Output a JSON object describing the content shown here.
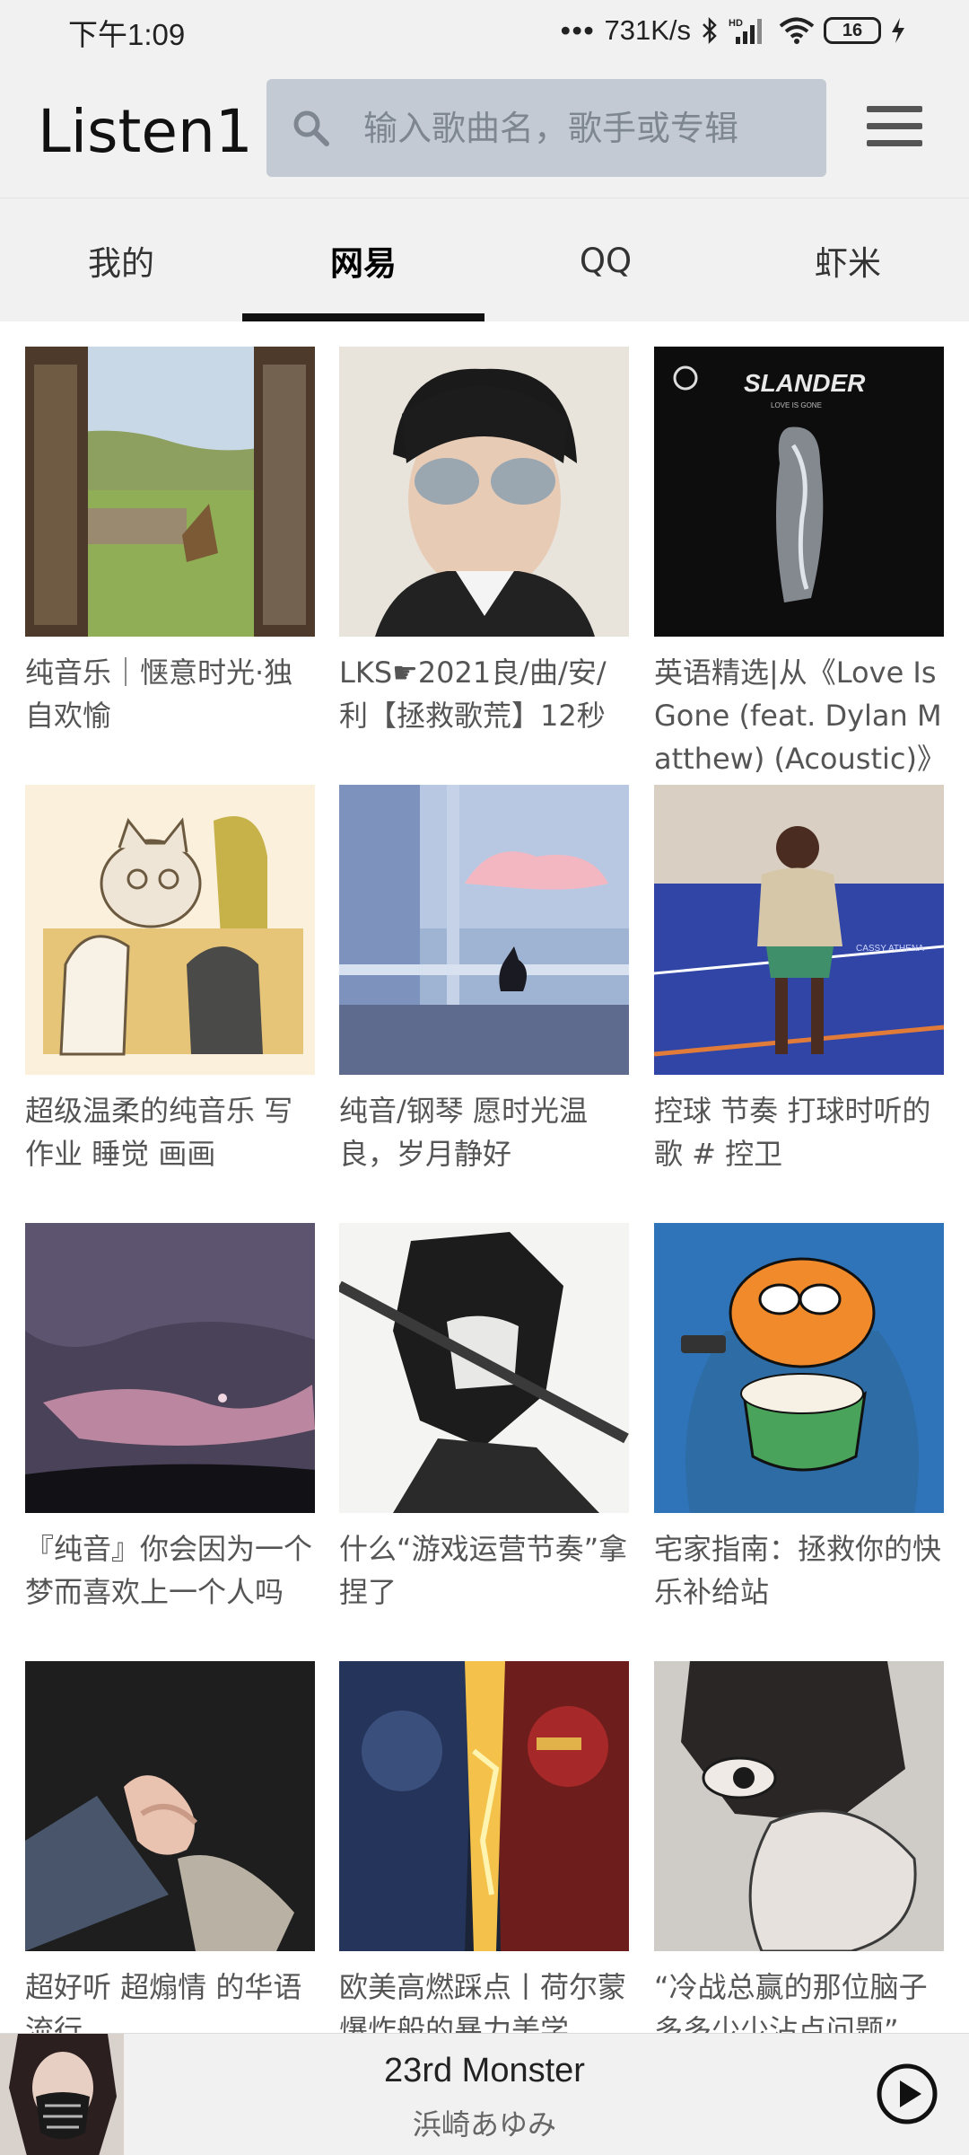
{
  "status_bar": {
    "time": "下午1:09",
    "network_speed": "731K/s",
    "battery": "16",
    "icons": [
      "bluetooth-icon",
      "hd-signal-icon",
      "wifi-icon",
      "battery-icon",
      "charging-icon"
    ]
  },
  "header": {
    "app_title": "Listen1",
    "search_placeholder": "输入歌曲名，歌手或专辑"
  },
  "tabs": [
    {
      "label": "我的",
      "active": false
    },
    {
      "label": "网易",
      "active": true
    },
    {
      "label": "QQ",
      "active": false
    },
    {
      "label": "虾米",
      "active": false
    }
  ],
  "playlists": [
    {
      "title": "纯音乐｜惬意时光·独自欢愉"
    },
    {
      "title": "LKS☛2021良/曲/安/利【拯救歌荒】12秒"
    },
    {
      "title": "英语精选|从《Love Is Gone (feat. Dylan Matthew) (Acoustic)》听起"
    },
    {
      "title": "超级温柔的纯音乐 写作业 睡觉 画画"
    },
    {
      "title": "纯音/钢琴 愿时光温良，岁月静好"
    },
    {
      "title": "控球 节奏 打球时听的歌 # 控卫"
    },
    {
      "title": "『纯音』你会因为一个梦而喜欢上一个人吗"
    },
    {
      "title": "什么“游戏运营节奏”拿捏了"
    },
    {
      "title": "宅家指南：拯救你的快乐补给站"
    },
    {
      "title": "超好听 超煽情 的华语流行"
    },
    {
      "title": "欧美高燃踩点丨荷尔蒙爆炸般的暴力美学"
    },
    {
      "title": "“冷战总赢的那位脑子多多少少沾点问题”"
    }
  ],
  "cover_text": {
    "slander_logo": "SLANDER",
    "slander_sub": "LOVE IS GONE",
    "jersey": "CASSY ATHENA"
  },
  "now_playing": {
    "song": "23rd Monster",
    "artist": "浜崎あゆみ"
  },
  "colors": {
    "background": "#f1f1f1",
    "search_bg": "#c3cad3",
    "tab_indicator": "#111111"
  }
}
